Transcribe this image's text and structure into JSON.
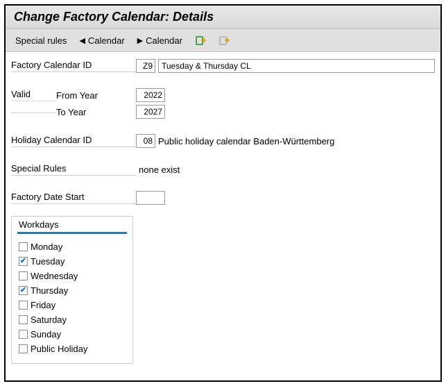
{
  "title": "Change Factory Calendar: Details",
  "toolbar": {
    "special_rules": "Special rules",
    "calendar_prev": "Calendar",
    "calendar_next": "Calendar"
  },
  "fields": {
    "factory_cal_id_label": "Factory Calendar ID",
    "factory_cal_id": "Z9",
    "factory_cal_desc": "Tuesday & Thursday CL",
    "valid_label": "Valid",
    "from_year_label": "From Year",
    "from_year": "2022",
    "to_year_label": "To Year",
    "to_year": "2027",
    "holiday_cal_id_label": "Holiday Calendar ID",
    "holiday_cal_id": "08",
    "holiday_cal_desc": "Public holiday calendar Baden-Württemberg",
    "special_rules_label": "Special Rules",
    "special_rules_value": "none exist",
    "factory_date_start_label": "Factory Date Start",
    "factory_date_start": ""
  },
  "workdays": {
    "title": "Workdays",
    "items": [
      {
        "label": "Monday",
        "checked": false
      },
      {
        "label": "Tuesday",
        "checked": true
      },
      {
        "label": "Wednesday",
        "checked": false
      },
      {
        "label": "Thursday",
        "checked": true
      },
      {
        "label": "Friday",
        "checked": false
      },
      {
        "label": "Saturday",
        "checked": false
      },
      {
        "label": "Sunday",
        "checked": false
      },
      {
        "label": "Public Holiday",
        "checked": false
      }
    ]
  }
}
